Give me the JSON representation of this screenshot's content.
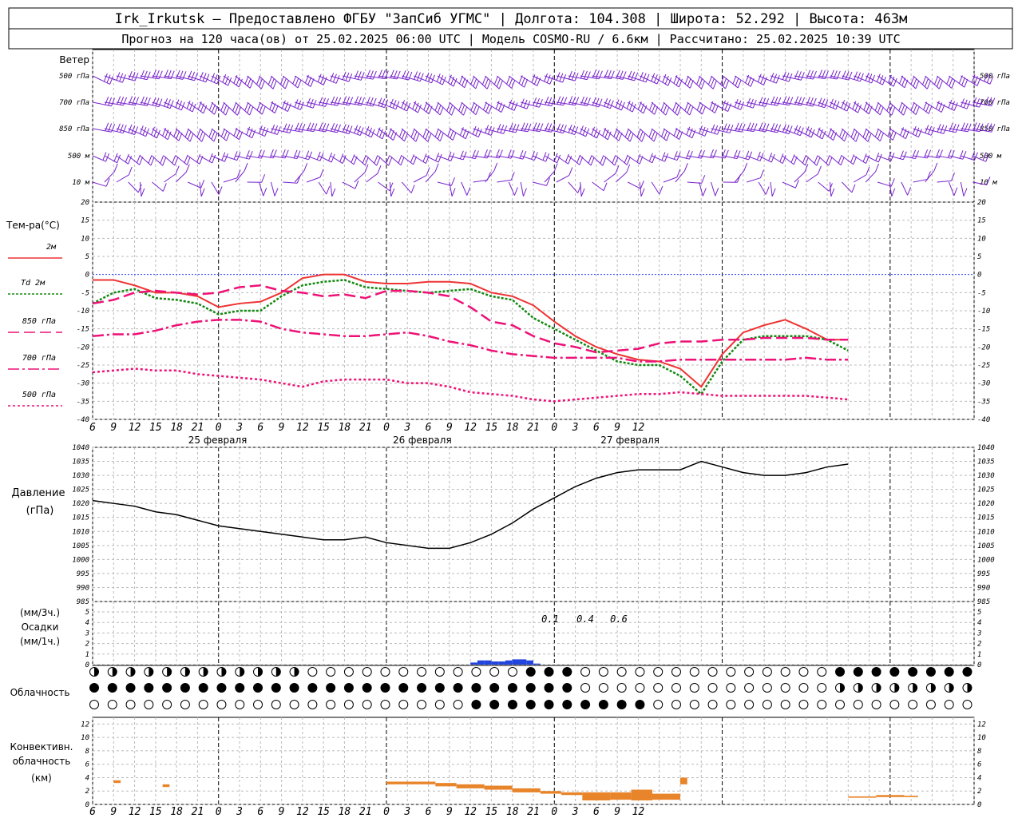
{
  "header": {
    "line1": "Irk_Irkutsk — Предоставлено ФГБУ \"ЗапСиб УГМС\" | Долгота: 104.308 | Широта: 52.292 | Высота: 463м",
    "line2": "Прогноз на 120 часа(ов) от 25.02.2025 06:00 UTC  | Модель COSMO-RU / 6.6км | Рассчитано: 25.02.2025 10:39 UTC"
  },
  "wind_panel": {
    "title": "Ветер",
    "levels": [
      "500 гПа",
      "700 гПа",
      "850 гПа",
      "500 м",
      "10  м"
    ],
    "right_levels": [
      "500 гПа",
      "700 гПа",
      "850 гПа",
      "500 м",
      "10 м"
    ]
  },
  "temp_panel": {
    "title": "Тем-ра(°C)",
    "legend": [
      "2м",
      "Td 2м",
      "850 гПа",
      "700 гПа",
      "500 гПа"
    ]
  },
  "pressure_panel": {
    "title": "Давление",
    "unit": "(гПа)"
  },
  "precip_panel": {
    "unit1": "(мм/3ч.)",
    "title": "Осадки",
    "unit2": "(мм/1ч.)",
    "labels": [
      "0.1",
      "0.4",
      "0.6"
    ]
  },
  "cloud_panel": {
    "title": "Облачность"
  },
  "conv_panel": {
    "title1": "Конвективн.",
    "title2": "облачность",
    "unit": "(км)"
  },
  "time_axis": {
    "hour_labels": [
      "6",
      "9",
      "12",
      "15",
      "18",
      "21",
      "0",
      "3",
      "6",
      "9",
      "12",
      "15",
      "18",
      "21",
      "0",
      "3",
      "6",
      "9",
      "12",
      "15",
      "18",
      "21",
      "0",
      "3",
      "6",
      "9",
      "12"
    ],
    "dates": [
      "25 февраля",
      "26 февраля",
      "27 февраля"
    ]
  },
  "colors": {
    "t2m": "#ee3333",
    "td": "#118811",
    "t850": "#ee1177",
    "t700": "#ee1177",
    "t500": "#ee1177",
    "wind": "#7722cc",
    "precip": "#2244dd",
    "conv": "#e8842a"
  },
  "chart_data": [
    {
      "type": "line",
      "title": "Тем-ра(°C)",
      "ylim": [
        -40,
        20
      ],
      "x_hours_from_start": [
        0,
        3,
        6,
        9,
        12,
        15,
        18,
        21,
        24,
        27,
        30,
        33,
        36,
        39,
        42,
        45,
        48,
        51,
        54,
        57,
        60,
        63,
        66,
        69,
        72,
        75,
        78,
        81,
        84,
        87,
        90,
        93,
        96,
        99,
        102,
        105,
        108
      ],
      "series": [
        {
          "name": "2м",
          "values": [
            -1.5,
            -1.5,
            -3,
            -5,
            -5,
            -6,
            -9,
            -8,
            -7.5,
            -5,
            -1,
            0,
            0,
            -2,
            -2.5,
            -2.5,
            -2,
            -2,
            -2.5,
            -5,
            -6,
            -8.5,
            -13,
            -17,
            -20,
            -22,
            -23.5,
            -24,
            -26,
            -31,
            -22,
            -16,
            -14,
            -12.5,
            -15,
            -18,
            -18
          ]
        },
        {
          "name": "Td 2м",
          "values": [
            -8,
            -5,
            -4,
            -6.5,
            -7,
            -8,
            -11,
            -10,
            -10,
            -6,
            -3,
            -2,
            -1.5,
            -3.5,
            -4,
            -4.5,
            -5,
            -4.5,
            -4,
            -6,
            -7,
            -12,
            -15,
            -18,
            -21,
            -24,
            -25,
            -25,
            -28,
            -33,
            -24,
            -18,
            -17,
            -17,
            -17,
            -18,
            -21
          ]
        },
        {
          "name": "850 гПа",
          "values": [
            -8,
            -7,
            -5,
            -4.5,
            -5,
            -5.5,
            -5,
            -3.5,
            -3,
            -4.5,
            -5,
            -6,
            -5.5,
            -6.5,
            -4.5,
            -4.5,
            -5,
            -6,
            -9,
            -13,
            -14,
            -17,
            -19,
            -20,
            -21.5,
            -21,
            -20.5,
            -19,
            -18.5,
            -18.5,
            -18,
            -18,
            -17.5,
            -17.5,
            -17.5,
            -18,
            -18
          ]
        },
        {
          "name": "700 гПа",
          "values": [
            -17,
            -16.5,
            -16.5,
            -15.5,
            -14,
            -13,
            -12.5,
            -12.5,
            -13,
            -15,
            -16,
            -16.5,
            -17,
            -17,
            -16.5,
            -16,
            -17,
            -18.5,
            -19.5,
            -21,
            -22,
            -22.5,
            -23,
            -23,
            -23,
            -23,
            -24,
            -24,
            -23.5,
            -23.5,
            -23.5,
            -23.5,
            -23.5,
            -23.5,
            -23,
            -23.5,
            -23.5
          ]
        },
        {
          "name": "500 гПа",
          "values": [
            -27,
            -26.5,
            -26,
            -26.5,
            -26.5,
            -27.5,
            -28,
            -28.5,
            -29,
            -30,
            -31,
            -29.5,
            -29,
            -29,
            -29,
            -30,
            -30,
            -31,
            -32.5,
            -33,
            -33.5,
            -34.5,
            -35,
            -34.5,
            -34,
            -33.5,
            -33,
            -33,
            -32.5,
            -33,
            -33.5,
            -33.5,
            -33.5,
            -33.5,
            -33.5,
            -34,
            -34.5
          ]
        }
      ]
    },
    {
      "type": "line",
      "title": "Давление",
      "ylabel": "(гПа)",
      "ylim": [
        985,
        1040
      ],
      "x_hours_from_start": [
        0,
        3,
        6,
        9,
        12,
        15,
        18,
        21,
        24,
        27,
        30,
        33,
        36,
        39,
        42,
        45,
        48,
        51,
        54,
        57,
        60,
        63,
        66,
        69,
        72,
        75,
        78,
        81,
        84,
        87,
        90,
        93,
        96,
        99,
        102,
        105,
        108
      ],
      "series": [
        {
          "name": "Давление",
          "values": [
            1021,
            1020,
            1019,
            1017,
            1016,
            1014,
            1012,
            1011,
            1010,
            1009,
            1008,
            1007,
            1007,
            1008,
            1006,
            1005,
            1004,
            1004,
            1006,
            1009,
            1013,
            1018,
            1022,
            1026,
            1029,
            1031,
            1032,
            1032,
            1032,
            1035,
            1033,
            1031,
            1030,
            1030,
            1031,
            1033,
            1034
          ]
        }
      ]
    },
    {
      "type": "bar",
      "title": "Осадки",
      "ylim": [
        0,
        5
      ],
      "x_hours_from_start": [
        54,
        55,
        56,
        57,
        58,
        59,
        60,
        61,
        62,
        63
      ],
      "series": [
        {
          "name": "мм/1ч.",
          "values": [
            0.2,
            0.4,
            0.4,
            0.3,
            0.3,
            0.4,
            0.5,
            0.5,
            0.4,
            0.1
          ]
        }
      ]
    },
    {
      "type": "bar",
      "title": "Конвективн. облачность",
      "ylabel": "(км)",
      "ylim": [
        0,
        13
      ],
      "segments_hours": [
        [
          3,
          4,
          3.2,
          3.6
        ],
        [
          10,
          11,
          2.6,
          3.0
        ],
        [
          42,
          49,
          3.0,
          3.4
        ],
        [
          49,
          52,
          2.7,
          3.2
        ],
        [
          52,
          56,
          2.4,
          3.0
        ],
        [
          56,
          60,
          2.2,
          2.8
        ],
        [
          60,
          64,
          1.8,
          2.4
        ],
        [
          64,
          67,
          1.6,
          2.0
        ],
        [
          67,
          70,
          1.4,
          1.8
        ],
        [
          70,
          74,
          0.6,
          1.8
        ],
        [
          74,
          77,
          0.7,
          1.8
        ],
        [
          77,
          80,
          0.6,
          2.2
        ],
        [
          80,
          84,
          0.7,
          1.6
        ],
        [
          84,
          85,
          3.0,
          4.0
        ],
        [
          108,
          112,
          1.0,
          1.2
        ],
        [
          112,
          116,
          1.1,
          1.4
        ],
        [
          116,
          118,
          1.1,
          1.3
        ]
      ]
    }
  ]
}
